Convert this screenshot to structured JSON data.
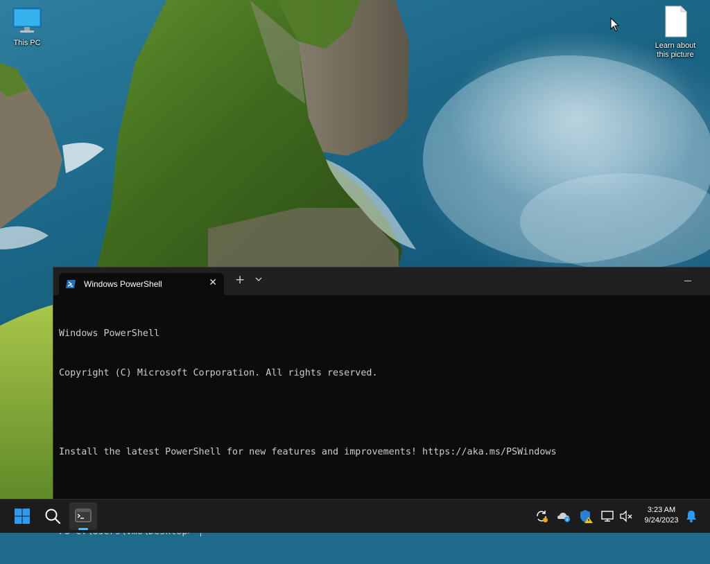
{
  "desktop": {
    "icons": [
      {
        "label": "This PC",
        "icon": "monitor-icon"
      },
      {
        "label": "Learn about this picture",
        "icon": "document-icon"
      }
    ]
  },
  "terminal": {
    "tab_title": "Windows PowerShell",
    "tab_icon": "powershell-icon",
    "new_tab_symbol": "+",
    "close_symbol": "✕",
    "console_lines": [
      "Windows PowerShell",
      "Copyright (C) Microsoft Corporation. All rights reserved.",
      "",
      "Install the latest PowerShell for new features and improvements! https://aka.ms/PSWindows",
      "",
      "PS C:\\Users\\vm6\\Desktop> "
    ],
    "colors": {
      "background": "#0c0c0c",
      "titlebar": "#202020",
      "text": "#cccccc"
    }
  },
  "taskbar": {
    "pinned": [
      "windows-start-icon",
      "search-icon",
      "terminal-icon"
    ],
    "tray_icons": [
      "sync-icon",
      "onedrive-icon",
      "defender-icon",
      "network-icon",
      "volume-muted-icon"
    ],
    "clock": {
      "time": "3:23 AM",
      "date": "9/24/2023"
    },
    "notification_icon": "bell-icon",
    "accent": "#4cc2ff"
  }
}
